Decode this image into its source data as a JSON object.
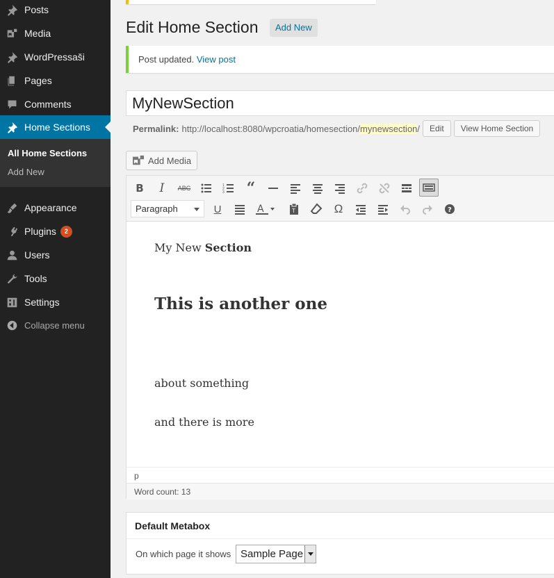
{
  "sidebar": {
    "items": [
      {
        "label": "Posts",
        "icon": "pin-icon"
      },
      {
        "label": "Media",
        "icon": "media-icon"
      },
      {
        "label": "WordPressaši",
        "icon": "pin-icon"
      },
      {
        "label": "Pages",
        "icon": "pages-icon"
      },
      {
        "label": "Comments",
        "icon": "comments-icon"
      },
      {
        "label": "Home Sections",
        "icon": "pin-icon"
      },
      {
        "label": "Appearance",
        "icon": "appearance-icon"
      },
      {
        "label": "Plugins",
        "icon": "plugins-icon",
        "badge": "2"
      },
      {
        "label": "Users",
        "icon": "users-icon"
      },
      {
        "label": "Tools",
        "icon": "tools-icon"
      },
      {
        "label": "Settings",
        "icon": "settings-icon"
      }
    ],
    "submenu": {
      "all": "All Home Sections",
      "add_new": "Add New"
    },
    "collapse": "Collapse menu"
  },
  "header": {
    "title": "Edit Home Section",
    "add_new": "Add New"
  },
  "notice": {
    "text": "Post updated.",
    "link": "View post"
  },
  "post": {
    "title": "MyNewSection",
    "permalink_label": "Permalink:",
    "permalink_base": "http://localhost:8080/wpcroatia/homesection/",
    "permalink_slug": "mynewsection",
    "permalink_end": "/",
    "edit_btn": "Edit",
    "view_btn": "View Home Section"
  },
  "editor": {
    "add_media": "Add Media",
    "format": "Paragraph",
    "content": {
      "line1_normal": "My New ",
      "line1_bold": "Section",
      "heading": "This is another one",
      "para2": "about something",
      "para3": "and there is more"
    },
    "path": "p",
    "word_count": "Word count: 13"
  },
  "metabox": {
    "title": "Default Metabox",
    "label": "On which page it shows",
    "selected": "Sample Page"
  },
  "colors": {
    "sidebar_bg": "#222222",
    "active_bg": "#0074a2",
    "link": "#0074a2",
    "notice_border": "#7ad03a",
    "badge": "#d54e21"
  }
}
